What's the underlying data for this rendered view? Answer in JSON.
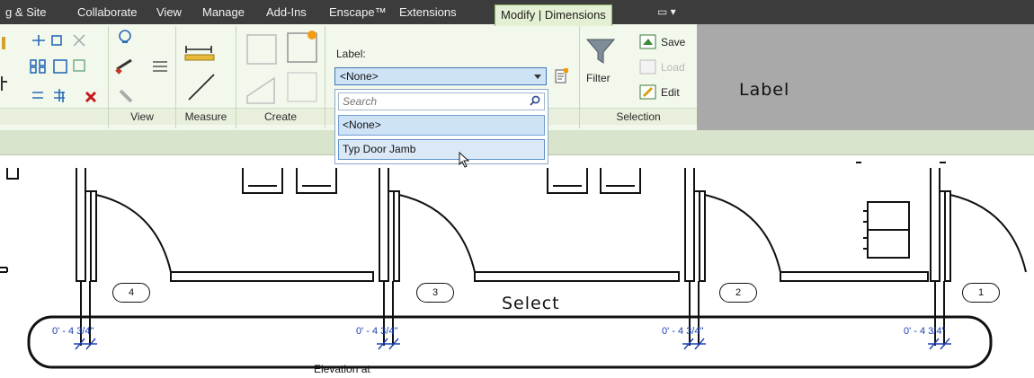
{
  "menu_tabs": [
    {
      "label": "g & Site"
    },
    {
      "label": "Collaborate"
    },
    {
      "label": "View"
    },
    {
      "label": "Manage"
    },
    {
      "label": "Add-Ins"
    },
    {
      "label": "Enscape™"
    },
    {
      "label": "Extensions"
    },
    {
      "label": "Modify | Dimensions"
    },
    {
      "label": "▭ ▾"
    }
  ],
  "ribbon": {
    "panels": [
      "View",
      "Measure",
      "Create",
      "Selection"
    ],
    "label_title": "Label:",
    "label_value": "<None>",
    "filter_label": "Filter",
    "save_label": "Save",
    "load_label": "Load",
    "edit_label": "Edit"
  },
  "dropdown": {
    "search_placeholder": "Search",
    "items": [
      "<None>",
      "Typ Door Jamb"
    ]
  },
  "annotations": {
    "label_callout": "Label",
    "select_callout": "Select"
  },
  "drawing": {
    "door_tags": [
      "4",
      "3",
      "2",
      "1"
    ],
    "dimension_text": "0' - 4  3/4\"",
    "elevation_text": "Elevation at"
  },
  "colors": {
    "menubar": "#3c3c3c",
    "ribbon": "#f3f8ec",
    "active_tab": "#e4f0d3",
    "dimension_blue": "#1b3fb0",
    "selection_blue": "#cfe3f7"
  }
}
